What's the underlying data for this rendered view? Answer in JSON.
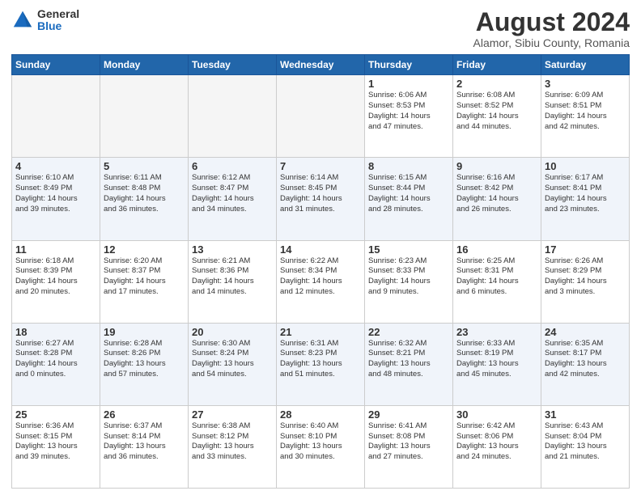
{
  "header": {
    "logo": {
      "general": "General",
      "blue": "Blue"
    },
    "month": "August 2024",
    "location": "Alamor, Sibiu County, Romania"
  },
  "days_header": [
    "Sunday",
    "Monday",
    "Tuesday",
    "Wednesday",
    "Thursday",
    "Friday",
    "Saturday"
  ],
  "weeks": [
    {
      "row_class": "row-week1",
      "days": [
        {
          "num": "",
          "info": "",
          "empty": true
        },
        {
          "num": "",
          "info": "",
          "empty": true
        },
        {
          "num": "",
          "info": "",
          "empty": true
        },
        {
          "num": "",
          "info": "",
          "empty": true
        },
        {
          "num": "1",
          "info": "Sunrise: 6:06 AM\nSunset: 8:53 PM\nDaylight: 14 hours\nand 47 minutes.",
          "empty": false
        },
        {
          "num": "2",
          "info": "Sunrise: 6:08 AM\nSunset: 8:52 PM\nDaylight: 14 hours\nand 44 minutes.",
          "empty": false
        },
        {
          "num": "3",
          "info": "Sunrise: 6:09 AM\nSunset: 8:51 PM\nDaylight: 14 hours\nand 42 minutes.",
          "empty": false
        }
      ]
    },
    {
      "row_class": "row-week2",
      "days": [
        {
          "num": "4",
          "info": "Sunrise: 6:10 AM\nSunset: 8:49 PM\nDaylight: 14 hours\nand 39 minutes.",
          "empty": false
        },
        {
          "num": "5",
          "info": "Sunrise: 6:11 AM\nSunset: 8:48 PM\nDaylight: 14 hours\nand 36 minutes.",
          "empty": false
        },
        {
          "num": "6",
          "info": "Sunrise: 6:12 AM\nSunset: 8:47 PM\nDaylight: 14 hours\nand 34 minutes.",
          "empty": false
        },
        {
          "num": "7",
          "info": "Sunrise: 6:14 AM\nSunset: 8:45 PM\nDaylight: 14 hours\nand 31 minutes.",
          "empty": false
        },
        {
          "num": "8",
          "info": "Sunrise: 6:15 AM\nSunset: 8:44 PM\nDaylight: 14 hours\nand 28 minutes.",
          "empty": false
        },
        {
          "num": "9",
          "info": "Sunrise: 6:16 AM\nSunset: 8:42 PM\nDaylight: 14 hours\nand 26 minutes.",
          "empty": false
        },
        {
          "num": "10",
          "info": "Sunrise: 6:17 AM\nSunset: 8:41 PM\nDaylight: 14 hours\nand 23 minutes.",
          "empty": false
        }
      ]
    },
    {
      "row_class": "row-week3",
      "days": [
        {
          "num": "11",
          "info": "Sunrise: 6:18 AM\nSunset: 8:39 PM\nDaylight: 14 hours\nand 20 minutes.",
          "empty": false
        },
        {
          "num": "12",
          "info": "Sunrise: 6:20 AM\nSunset: 8:37 PM\nDaylight: 14 hours\nand 17 minutes.",
          "empty": false
        },
        {
          "num": "13",
          "info": "Sunrise: 6:21 AM\nSunset: 8:36 PM\nDaylight: 14 hours\nand 14 minutes.",
          "empty": false
        },
        {
          "num": "14",
          "info": "Sunrise: 6:22 AM\nSunset: 8:34 PM\nDaylight: 14 hours\nand 12 minutes.",
          "empty": false
        },
        {
          "num": "15",
          "info": "Sunrise: 6:23 AM\nSunset: 8:33 PM\nDaylight: 14 hours\nand 9 minutes.",
          "empty": false
        },
        {
          "num": "16",
          "info": "Sunrise: 6:25 AM\nSunset: 8:31 PM\nDaylight: 14 hours\nand 6 minutes.",
          "empty": false
        },
        {
          "num": "17",
          "info": "Sunrise: 6:26 AM\nSunset: 8:29 PM\nDaylight: 14 hours\nand 3 minutes.",
          "empty": false
        }
      ]
    },
    {
      "row_class": "row-week4",
      "days": [
        {
          "num": "18",
          "info": "Sunrise: 6:27 AM\nSunset: 8:28 PM\nDaylight: 14 hours\nand 0 minutes.",
          "empty": false
        },
        {
          "num": "19",
          "info": "Sunrise: 6:28 AM\nSunset: 8:26 PM\nDaylight: 13 hours\nand 57 minutes.",
          "empty": false
        },
        {
          "num": "20",
          "info": "Sunrise: 6:30 AM\nSunset: 8:24 PM\nDaylight: 13 hours\nand 54 minutes.",
          "empty": false
        },
        {
          "num": "21",
          "info": "Sunrise: 6:31 AM\nSunset: 8:23 PM\nDaylight: 13 hours\nand 51 minutes.",
          "empty": false
        },
        {
          "num": "22",
          "info": "Sunrise: 6:32 AM\nSunset: 8:21 PM\nDaylight: 13 hours\nand 48 minutes.",
          "empty": false
        },
        {
          "num": "23",
          "info": "Sunrise: 6:33 AM\nSunset: 8:19 PM\nDaylight: 13 hours\nand 45 minutes.",
          "empty": false
        },
        {
          "num": "24",
          "info": "Sunrise: 6:35 AM\nSunset: 8:17 PM\nDaylight: 13 hours\nand 42 minutes.",
          "empty": false
        }
      ]
    },
    {
      "row_class": "row-week5",
      "days": [
        {
          "num": "25",
          "info": "Sunrise: 6:36 AM\nSunset: 8:15 PM\nDaylight: 13 hours\nand 39 minutes.",
          "empty": false
        },
        {
          "num": "26",
          "info": "Sunrise: 6:37 AM\nSunset: 8:14 PM\nDaylight: 13 hours\nand 36 minutes.",
          "empty": false
        },
        {
          "num": "27",
          "info": "Sunrise: 6:38 AM\nSunset: 8:12 PM\nDaylight: 13 hours\nand 33 minutes.",
          "empty": false
        },
        {
          "num": "28",
          "info": "Sunrise: 6:40 AM\nSunset: 8:10 PM\nDaylight: 13 hours\nand 30 minutes.",
          "empty": false
        },
        {
          "num": "29",
          "info": "Sunrise: 6:41 AM\nSunset: 8:08 PM\nDaylight: 13 hours\nand 27 minutes.",
          "empty": false
        },
        {
          "num": "30",
          "info": "Sunrise: 6:42 AM\nSunset: 8:06 PM\nDaylight: 13 hours\nand 24 minutes.",
          "empty": false
        },
        {
          "num": "31",
          "info": "Sunrise: 6:43 AM\nSunset: 8:04 PM\nDaylight: 13 hours\nand 21 minutes.",
          "empty": false
        }
      ]
    }
  ]
}
